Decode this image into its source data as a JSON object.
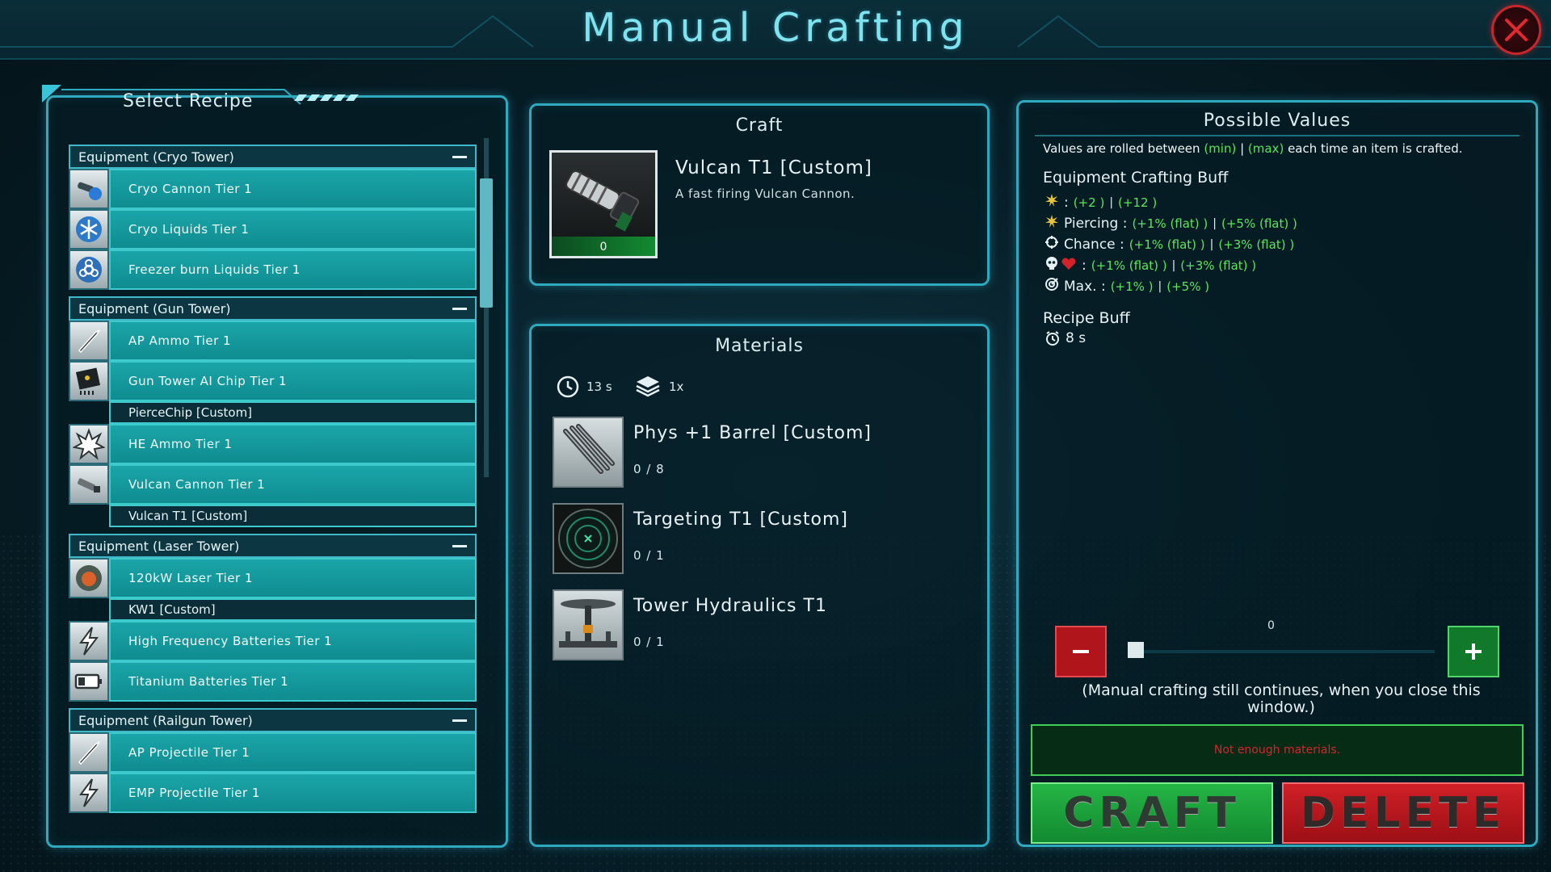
{
  "header": {
    "title": "Manual Crafting"
  },
  "recipes": {
    "title": "Select Recipe",
    "groups": [
      {
        "name": "Equipment (Cryo Tower)",
        "items": [
          {
            "label": "Cryo Cannon Tier 1",
            "icon": "cannon-icon"
          },
          {
            "label": "Cryo Liquids Tier 1",
            "icon": "snowflake-icon"
          },
          {
            "label": "Freezer burn Liquids Tier 1",
            "icon": "biohazard-icon"
          }
        ]
      },
      {
        "name": "Equipment (Gun Tower)",
        "items": [
          {
            "label": "AP Ammo Tier 1",
            "icon": "bullet-icon"
          },
          {
            "label": "Gun Tower AI Chip Tier 1",
            "icon": "chip-icon"
          },
          {
            "label": "PierceChip [Custom]",
            "sub": true
          },
          {
            "label": "HE Ammo Tier 1",
            "icon": "explosion-icon"
          },
          {
            "label": "Vulcan Cannon Tier 1",
            "icon": "vulcan-icon"
          },
          {
            "label": "Vulcan T1 [Custom]",
            "sub": true
          }
        ]
      },
      {
        "name": "Equipment (Laser Tower)",
        "items": [
          {
            "label": "120kW Laser Tier 1",
            "icon": "laser-icon"
          },
          {
            "label": "KW1 [Custom]",
            "sub": true
          },
          {
            "label": "High Frequency Batteries Tier 1",
            "icon": "lightning-icon"
          },
          {
            "label": "Titanium Batteries Tier 1",
            "icon": "battery-icon"
          }
        ]
      },
      {
        "name": "Equipment (Railgun Tower)",
        "items": [
          {
            "label": "AP Projectile Tier 1",
            "icon": "bullet-icon"
          },
          {
            "label": "EMP Projectile Tier 1",
            "icon": "lightning-icon"
          }
        ]
      }
    ]
  },
  "craft": {
    "title": "Craft",
    "item_name": "Vulcan T1 [Custom]",
    "item_desc": "A fast firing Vulcan Cannon.",
    "item_count": "0"
  },
  "materials": {
    "title": "Materials",
    "time": "13 s",
    "stack": "1x",
    "items": [
      {
        "name": "Phys +1 Barrel [Custom]",
        "count": "0 / 8",
        "icon": "barrel-icon"
      },
      {
        "name": "Targeting T1 [Custom]",
        "count": "0 / 1",
        "icon": "radar-icon"
      },
      {
        "name": "Tower Hydraulics T1",
        "count": "0 / 1",
        "icon": "hydraulics-icon"
      }
    ]
  },
  "values": {
    "title": "Possible Values",
    "note_a": "Values are rolled between ",
    "note_min": "(min)",
    "note_sep": " | ",
    "note_max": "(max)",
    "note_b": " each time an item is crafted.",
    "equip_head": "Equipment Crafting Buff",
    "buffs": [
      {
        "icon": "burst-icon",
        "label": ": ",
        "min": "(+2 )",
        "sep": " | ",
        "max": "(+12 )"
      },
      {
        "icon": "burst-icon",
        "label": "Piercing : ",
        "min": "(+1% (flat) )",
        "sep": " | ",
        "max": "(+5% (flat) )"
      },
      {
        "icon": "crosshair-icon",
        "label": "Chance : ",
        "min": "(+1% (flat) )",
        "sep": " | ",
        "max": "(+3% (flat) )"
      },
      {
        "icon": "skull-heart-icon",
        "label": ": ",
        "min": "(+1% (flat) )",
        "sep": " | ",
        "max": "(+3% (flat) )"
      },
      {
        "icon": "target-icon",
        "label": "Max. : ",
        "min": "(+1% )",
        "sep": " | ",
        "max": "(+5% )"
      }
    ],
    "recipe_head": "Recipe Buff",
    "recipe_time": "8 s",
    "quantity": "0",
    "manual_note": "(Manual crafting still continues, when you close this window.)",
    "status": "Not enough materials.",
    "craft_label": "CRAFT",
    "delete_label": "DELETE"
  },
  "colors": {
    "accent": "#2ea9bd",
    "row": "#1aa5a8",
    "green": "#59e35a",
    "red": "#d6252a"
  }
}
